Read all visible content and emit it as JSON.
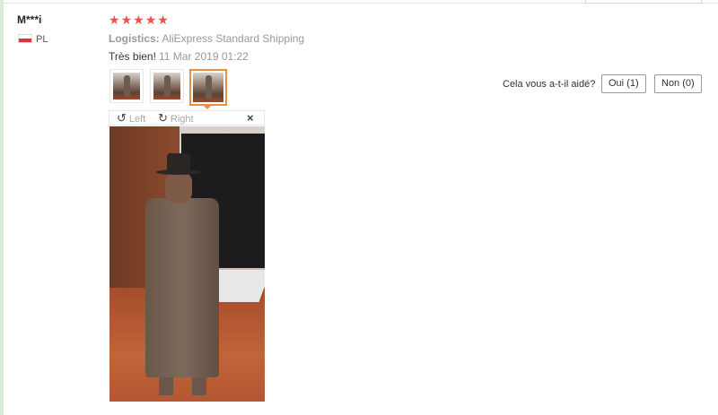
{
  "review": {
    "user_name": "M***i",
    "country": "PL",
    "rating": 5,
    "stars": [
      "★",
      "★",
      "★",
      "★",
      "★"
    ],
    "logistics_label": "Logistics:",
    "logistics_value": "AliExpress Standard Shipping",
    "text": "Très bien!",
    "date": "11 Mar 2019 01:22",
    "photo_count": 3,
    "active_photo": 3
  },
  "viewer": {
    "rotate_left_label": "Left",
    "rotate_right_label": "Right",
    "rotate_left_icon": "↺",
    "rotate_right_icon": "↻",
    "close_icon": "×"
  },
  "helpful": {
    "question": "Cela vous a-t-il aidé?",
    "yes_label": "Oui (1)",
    "no_label": "Non (0)"
  },
  "colors": {
    "star": "#f0504b",
    "active_border": "#e8903d"
  }
}
